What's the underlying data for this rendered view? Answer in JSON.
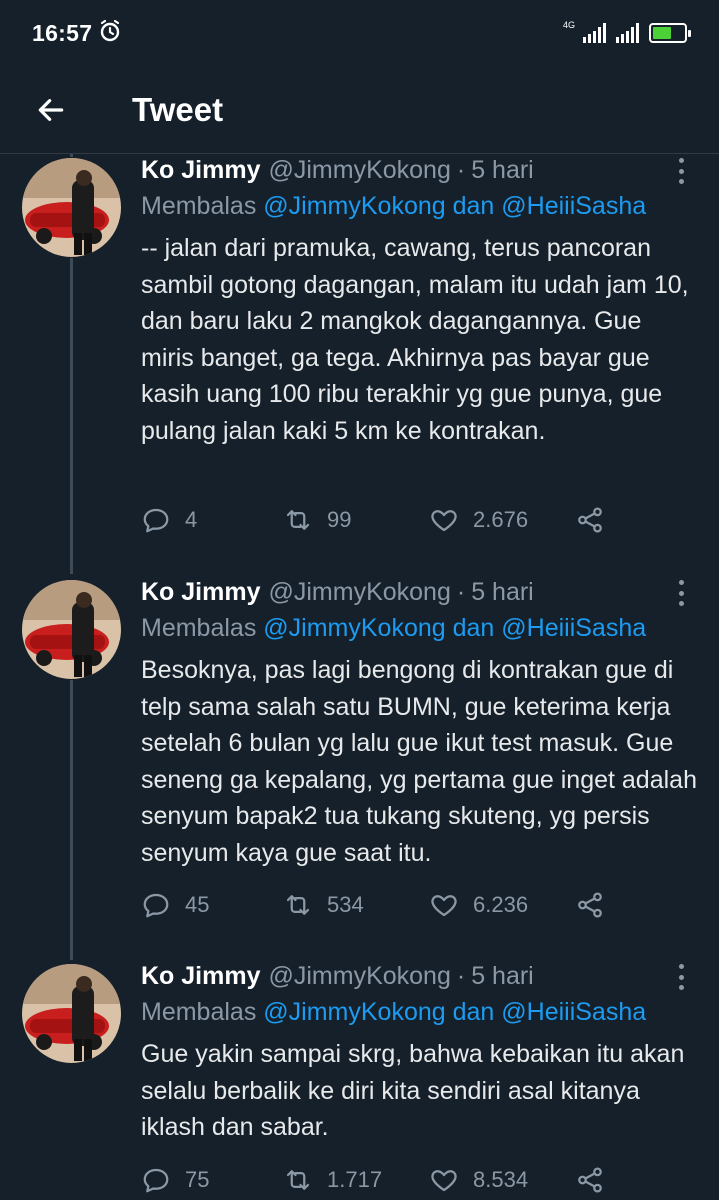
{
  "status_bar": {
    "time": "16:57",
    "network_label": "4G",
    "colors": {
      "battery_fill": "#4cd137"
    }
  },
  "header": {
    "title": "Tweet",
    "back_icon": "arrow-left-icon"
  },
  "tweets": [
    {
      "name": "Ko Jimmy",
      "handle": "@JimmyKokong",
      "separator": "·",
      "time": "5 hari",
      "reply_prefix": "Membalas",
      "reply_mentions": "@JimmyKokong dan @HeiiiSasha",
      "text": "-- jalan dari pramuka, cawang, terus pancoran sambil gotong dagangan, malam itu udah jam 10, dan baru laku 2 mangkok dagangannya. Gue miris banget, ga tega. Akhirnya pas bayar gue kasih uang 100 ribu terakhir yg gue punya, gue pulang jalan kaki 5 km ke kontrakan.",
      "replies": "4",
      "retweets": "99",
      "likes": "2.676"
    },
    {
      "name": "Ko Jimmy",
      "handle": "@JimmyKokong",
      "separator": "·",
      "time": "5 hari",
      "reply_prefix": "Membalas",
      "reply_mentions": "@JimmyKokong dan @HeiiiSasha",
      "text": "Besoknya, pas lagi bengong di kontrakan gue di telp sama salah satu BUMN, gue keterima kerja setelah 6 bulan yg lalu gue ikut test masuk. Gue seneng ga kepalang, yg pertama gue inget adalah senyum bapak2 tua tukang skuteng, yg persis senyum kaya gue saat itu.",
      "replies": "45",
      "retweets": "534",
      "likes": "6.236"
    },
    {
      "name": "Ko Jimmy",
      "handle": "@JimmyKokong",
      "separator": "·",
      "time": "5 hari",
      "reply_prefix": "Membalas",
      "reply_mentions": "@JimmyKokong dan @HeiiiSasha",
      "text": "Gue yakin sampai skrg, bahwa kebaikan itu akan selalu berbalik ke diri kita sendiri asal kitanya iklash dan sabar.",
      "replies": "75",
      "retweets": "1.717",
      "likes": "8.534"
    }
  ],
  "colors": {
    "background": "#15202b",
    "text": "#e7e9ea",
    "muted": "#8b98a5",
    "link": "#1d9bf0",
    "thread_line": "#3d4a57"
  }
}
